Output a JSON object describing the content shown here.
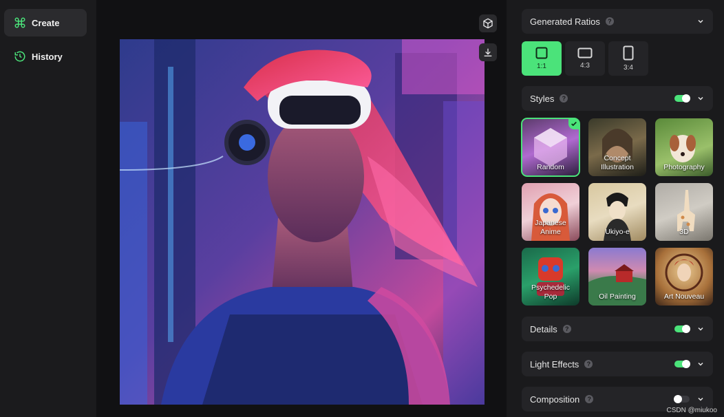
{
  "sidebar": {
    "items": [
      {
        "label": "Create",
        "icon": "command-icon",
        "active": true
      },
      {
        "label": "History",
        "icon": "history-icon",
        "active": false
      }
    ]
  },
  "canvas": {
    "actions": [
      "cube-icon",
      "download-icon"
    ]
  },
  "panel": {
    "ratios": {
      "title": "Generated Ratios",
      "options": [
        {
          "label": "1:1",
          "selected": true
        },
        {
          "label": "4:3",
          "selected": false
        },
        {
          "label": "3:4",
          "selected": false
        }
      ]
    },
    "styles": {
      "title": "Styles",
      "enabled": true,
      "items": [
        {
          "label": "Random",
          "selected": true
        },
        {
          "label": "Concept Illustration",
          "selected": false
        },
        {
          "label": "Photography",
          "selected": false
        },
        {
          "label": "Japanese Anime",
          "selected": false
        },
        {
          "label": "Ukiyo-e",
          "selected": false
        },
        {
          "label": "3D",
          "selected": false
        },
        {
          "label": "Psychedelic Pop",
          "selected": false
        },
        {
          "label": "Oil Painting",
          "selected": false
        },
        {
          "label": "Art Nouveau",
          "selected": false
        }
      ]
    },
    "details": {
      "title": "Details",
      "enabled": true
    },
    "light_effects": {
      "title": "Light Effects",
      "enabled": true
    },
    "composition": {
      "title": "Composition",
      "enabled": false
    }
  },
  "watermark": "CSDN @miukoo",
  "colors": {
    "accent": "#4be37a",
    "panel": "#242427",
    "background": "#1a1a1c"
  }
}
